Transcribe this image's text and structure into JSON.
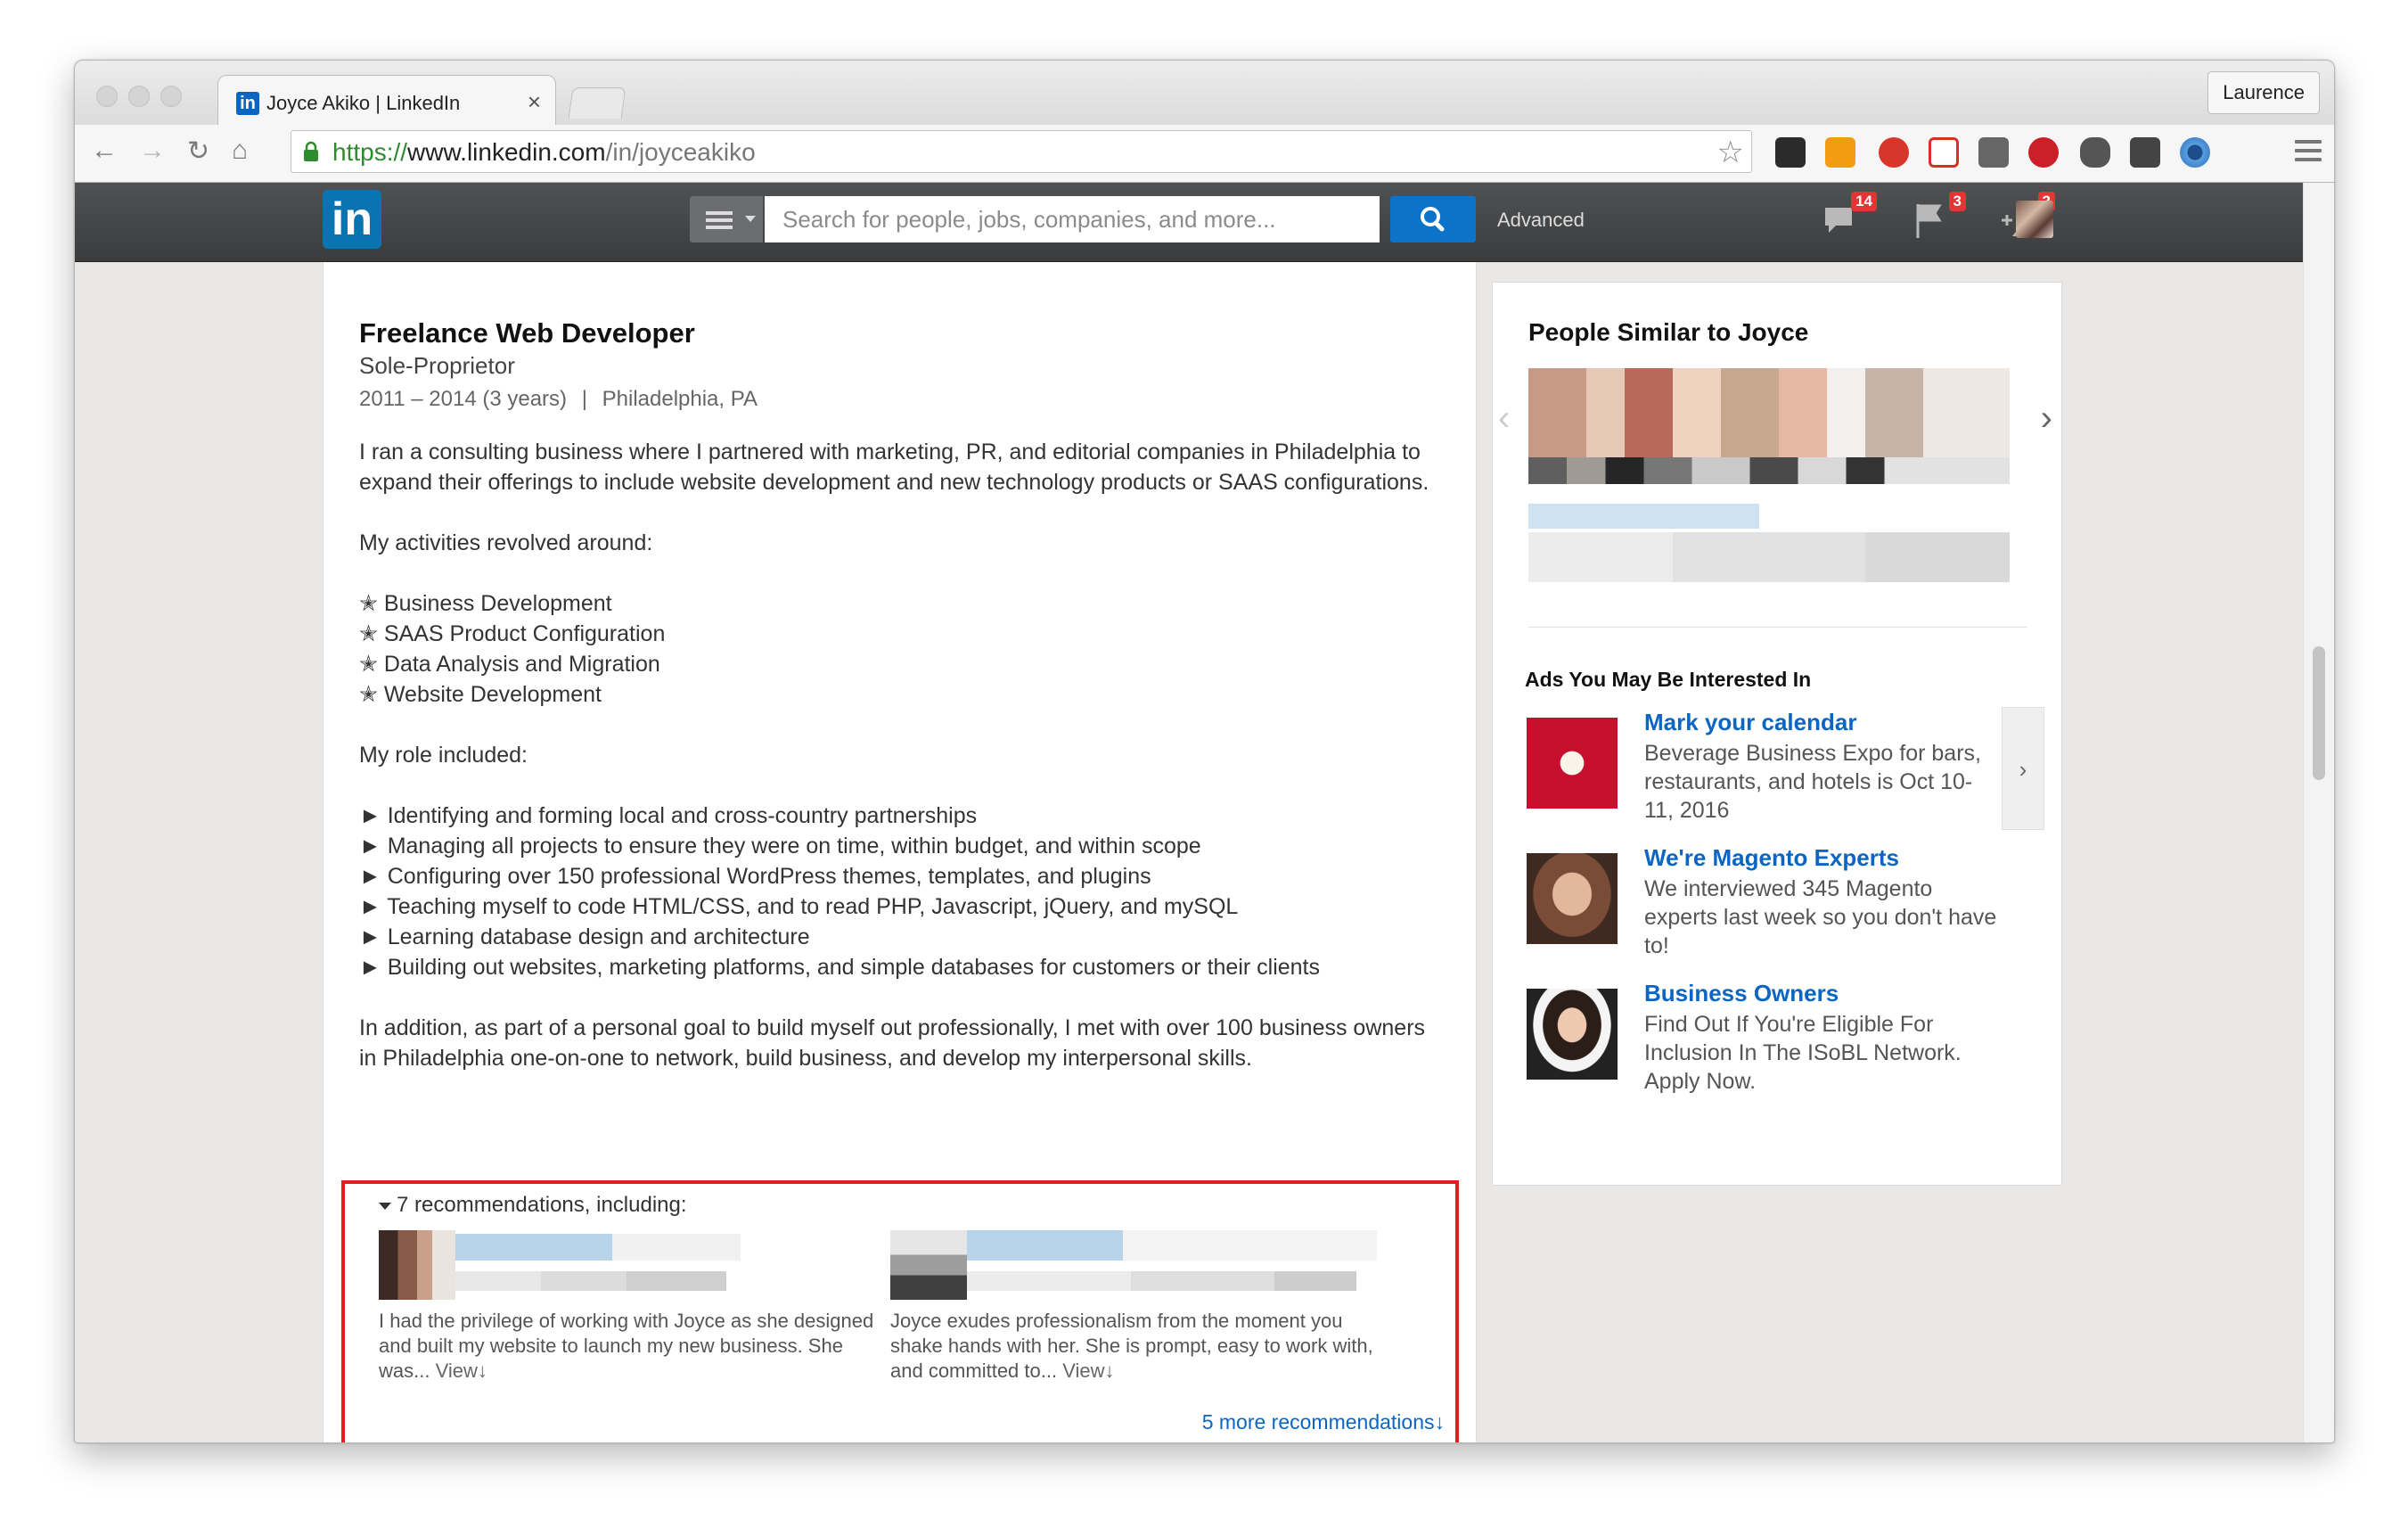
{
  "browser": {
    "tab_title": "Joyce Akiko | LinkedIn",
    "tab_close": "×",
    "profile_button": "Laurence",
    "url_scheme": "https://",
    "url_host": "www.linkedin.com",
    "url_path": "/in/joyceakiko"
  },
  "linkedin_nav": {
    "logo": "in",
    "search_placeholder": "Search for people, jobs, companies, and more...",
    "advanced_label": "Advanced",
    "messages_badge": "14",
    "notifications_badge": "3",
    "connections_badge": "2"
  },
  "position": {
    "title": "Freelance Web Developer",
    "company": "Sole-Proprietor",
    "dates": "2011 – 2014 (3 years)",
    "separator": "|",
    "location": "Philadelphia, PA",
    "intro": "I ran a consulting business where I partnered with marketing, PR, and editorial companies in Philadelphia to expand their offerings to include website development and new technology products or SAAS configurations.",
    "activities_heading": "My activities revolved around:",
    "activities": [
      "✭ Business Development",
      "✭ SAAS Product Configuration",
      "✭ Data Analysis and Migration",
      "✭ Website Development"
    ],
    "role_heading": "My role included:",
    "roles": [
      "► Identifying and forming local and cross-country partnerships",
      "► Managing all projects to ensure they were on time, within budget, and within scope",
      "► Configuring over 150 professional WordPress themes, templates, and plugins",
      "► Teaching myself to code HTML/CSS, and to read PHP, Javascript, jQuery, and mySQL",
      "► Learning database design and architecture",
      "► Building out websites, marketing platforms, and simple databases for customers or their clients"
    ],
    "closing": "In addition, as part of a personal goal to build myself out professionally, I met with over 100 business owners in Philadelphia one-on-one to network, build business, and develop my interpersonal skills."
  },
  "recommendations": {
    "header": "7 recommendations, including:",
    "items": [
      {
        "text": "I had the privilege of working with Joyce as she designed and built my website to launch my new business. She was...",
        "view": "View↓"
      },
      {
        "text": "Joyce exudes professionalism from the moment you shake hands with her. She is prompt, easy to work with, and committed to...",
        "view": "View↓"
      }
    ],
    "more": "5 more recommendations↓"
  },
  "sidebar": {
    "similar_title": "People Similar to Joyce",
    "ads_title": "Ads You May Be Interested In",
    "ads": [
      {
        "title": "Mark your calendar",
        "body": "Beverage Business Expo for bars, restaurants, and hotels is Oct 10-11, 2016"
      },
      {
        "title": "We're Magento Experts",
        "body": "We interviewed 345 Magento experts last week so you don't have to!"
      },
      {
        "title": "Business Owners",
        "body": "Find Out If You're Eligible For Inclusion In The ISoBL Network. Apply Now."
      }
    ],
    "ads_next": "›",
    "carousel_prev": "‹",
    "carousel_next": "›"
  },
  "colors": {
    "linkedin_blue": "#0a66c2",
    "highlight_red": "#e31e1e",
    "nav_dark": "#3b3c3e"
  }
}
